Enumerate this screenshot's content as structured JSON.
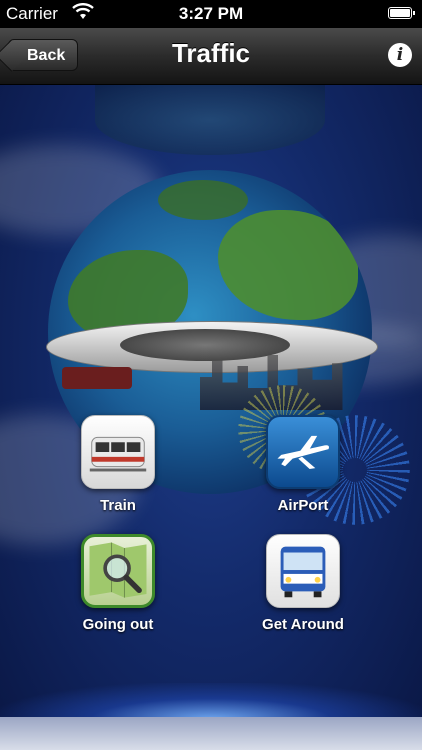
{
  "status_bar": {
    "carrier": "Carrier",
    "time": "3:27 PM"
  },
  "nav": {
    "back_label": "Back",
    "title": "Traffic",
    "info_label": "i"
  },
  "apps": [
    {
      "label": "Train",
      "icon": "train-icon"
    },
    {
      "label": "AirPort",
      "icon": "airplane-icon"
    },
    {
      "label": "Going out",
      "icon": "map-magnifier-icon"
    },
    {
      "label": "Get Around",
      "icon": "bus-icon"
    }
  ]
}
